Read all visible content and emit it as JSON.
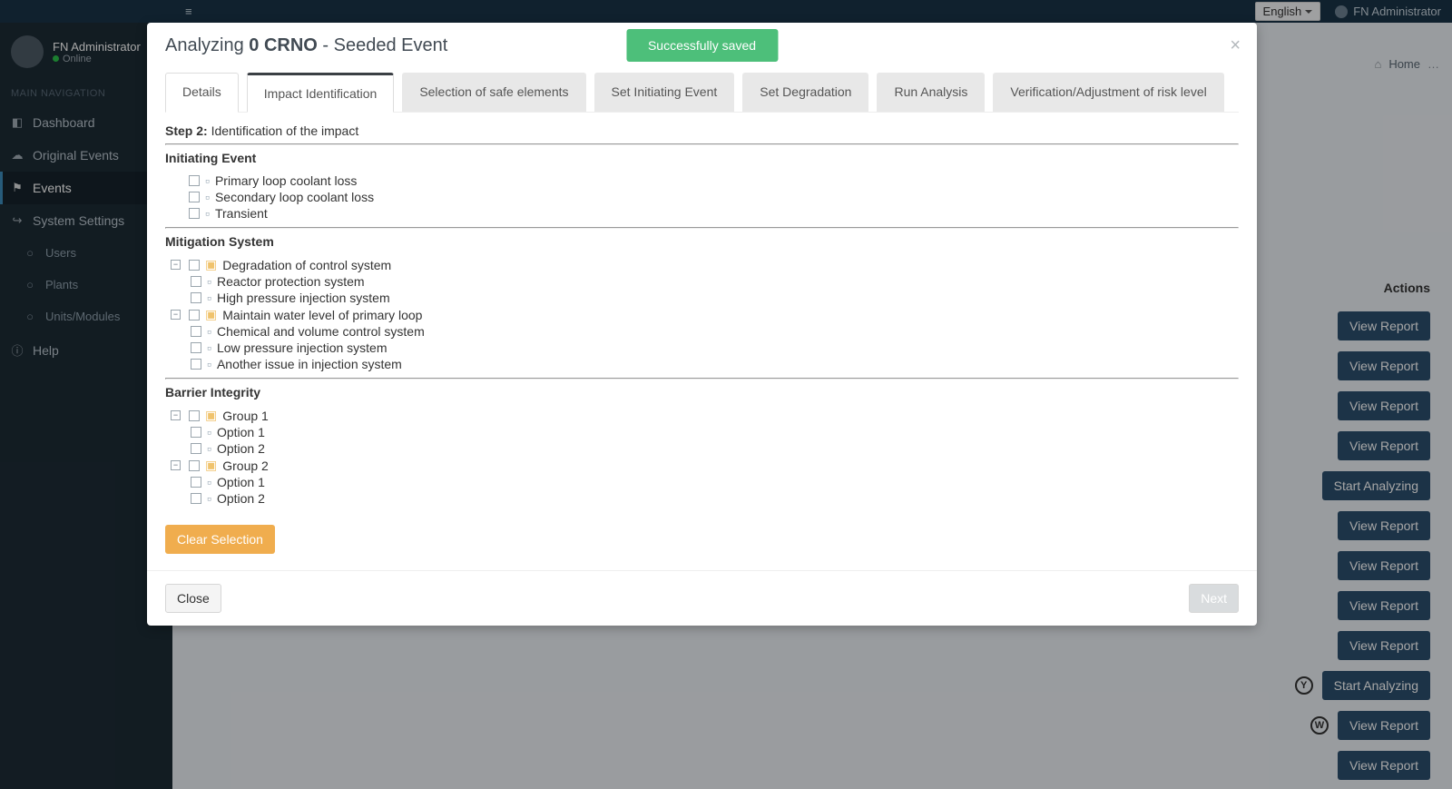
{
  "topbar": {
    "language": "English",
    "username": "FN Administrator"
  },
  "sidebar": {
    "username": "FN Administrator",
    "status": "Online",
    "header": "MAIN NAVIGATION",
    "items": [
      {
        "icon": "◧",
        "label": "Dashboard"
      },
      {
        "icon": "☁",
        "label": "Original Events"
      },
      {
        "icon": "⚑",
        "label": "Events",
        "active": true
      },
      {
        "icon": "↪",
        "label": "System Settings"
      },
      {
        "icon": "○",
        "label": "Users",
        "sub": true
      },
      {
        "icon": "○",
        "label": "Plants",
        "sub": true
      },
      {
        "icon": "○",
        "label": "Units/Modules",
        "sub": true
      },
      {
        "icon": "ⓘ",
        "label": "Help"
      }
    ]
  },
  "breadcrumb": {
    "home": "Home",
    "trail": "…"
  },
  "page": {
    "actions_header": "Actions",
    "buttons": [
      "View Report",
      "View Report",
      "View Report",
      "View Report",
      "Start Analyzing",
      "View Report",
      "View Report",
      "View Report",
      "View Report",
      "Start Analyzing",
      "View Report",
      "View Report"
    ],
    "row_badges": [
      "Y",
      "W"
    ]
  },
  "modal": {
    "title_prefix": "Analyzing ",
    "title_bold": "0 CRNO",
    "title_suffix": " - Seeded Event",
    "toast": "Successfully saved",
    "tabs": [
      "Details",
      "Impact Identification",
      "Selection of safe elements",
      "Set Initiating Event",
      "Set Degradation",
      "Run Analysis",
      "Verification/Adjustment of risk level"
    ],
    "step_label": "Step 2:",
    "step_text": "Identification of the impact",
    "sections": {
      "initiating": {
        "title": "Initiating Event",
        "items": [
          "Primary loop coolant loss",
          "Secondary loop coolant loss",
          "Transient"
        ]
      },
      "mitigation": {
        "title": "Mitigation System",
        "groups": [
          {
            "label": "Degradation of control system",
            "children": [
              "Reactor protection system",
              "High pressure injection system"
            ]
          },
          {
            "label": "Maintain water level of primary loop",
            "children": [
              "Chemical and volume control system",
              "Low pressure injection system",
              "Another issue in injection system"
            ]
          }
        ]
      },
      "barrier": {
        "title": "Barrier Integrity",
        "groups": [
          {
            "label": "Group 1",
            "children": [
              "Option 1",
              "Option 2"
            ]
          },
          {
            "label": "Group 2",
            "children": [
              "Option 1",
              "Option 2"
            ]
          }
        ]
      }
    },
    "clear": "Clear Selection",
    "close": "Close",
    "next": "Next"
  }
}
